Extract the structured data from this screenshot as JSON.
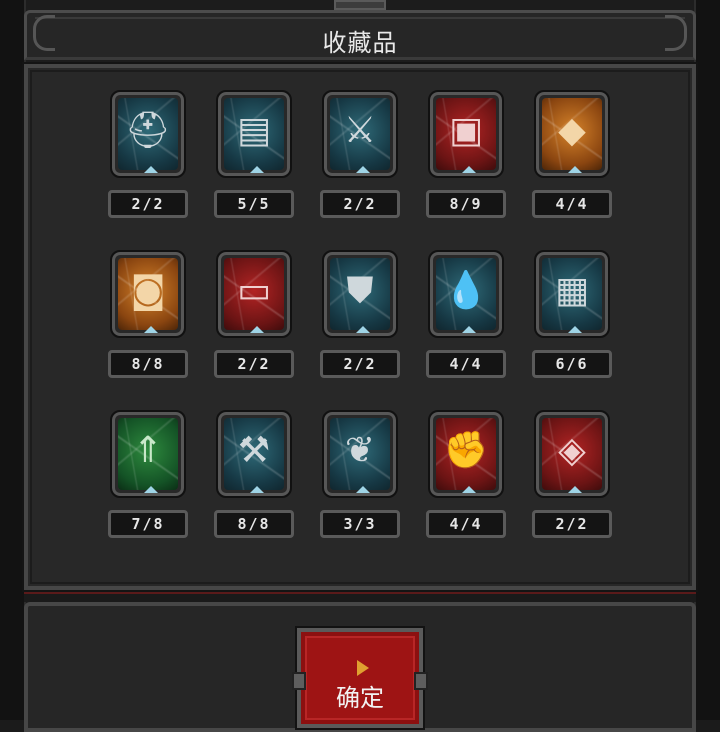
{
  "title": "收藏品",
  "confirm_label": "确定",
  "items": [
    {
      "icon": "helmet-icon",
      "glyph": "⛑",
      "theme": "teal",
      "count": "2/2"
    },
    {
      "icon": "scroll-card-icon",
      "glyph": "▤",
      "theme": "teal",
      "count": "5/5"
    },
    {
      "icon": "crossed-swords-icon",
      "glyph": "⚔",
      "theme": "teal",
      "count": "2/2"
    },
    {
      "icon": "treasure-chest-icon",
      "glyph": "▣",
      "theme": "red",
      "count": "8/9"
    },
    {
      "icon": "book-icon",
      "glyph": "◆",
      "theme": "orange",
      "count": "4/4"
    },
    {
      "icon": "barrel-icon",
      "glyph": "◙",
      "theme": "orange",
      "count": "8/8"
    },
    {
      "icon": "paper-scroll-icon",
      "glyph": "▭",
      "theme": "red",
      "count": "2/2"
    },
    {
      "icon": "armor-icon",
      "glyph": "⛊",
      "theme": "teal",
      "count": "2/2"
    },
    {
      "icon": "water-drop-icon",
      "glyph": "💧",
      "theme": "teal",
      "count": "4/4"
    },
    {
      "icon": "wooden-chest-icon",
      "glyph": "▦",
      "theme": "teal",
      "count": "6/6"
    },
    {
      "icon": "arrowhead-icon",
      "glyph": "⇑",
      "theme": "green",
      "count": "7/8"
    },
    {
      "icon": "hammer-icon",
      "glyph": "⚒",
      "theme": "teal",
      "count": "8/8"
    },
    {
      "icon": "wing-icon",
      "glyph": "❦",
      "theme": "teal",
      "count": "3/3"
    },
    {
      "icon": "fist-icon",
      "glyph": "✊",
      "theme": "red",
      "count": "4/4"
    },
    {
      "icon": "gem-shield-icon",
      "glyph": "◈",
      "theme": "red",
      "count": "2/2"
    }
  ]
}
